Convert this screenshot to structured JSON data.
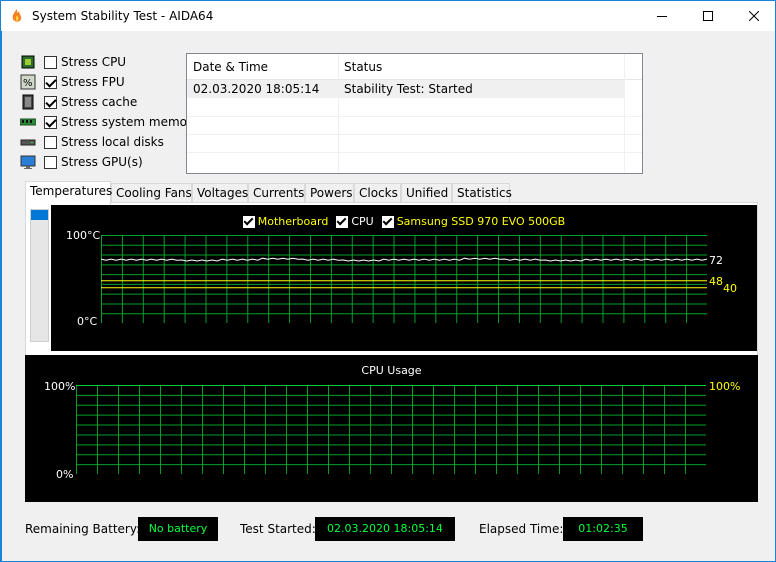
{
  "window": {
    "title": "System Stability Test - AIDA64",
    "minimize_icon": "minimize-icon",
    "maximize_icon": "maximize-icon",
    "close_icon": "close-icon"
  },
  "stress_options": [
    {
      "label": "Stress CPU",
      "checked": false,
      "icon": "cpu-chip-icon"
    },
    {
      "label": "Stress FPU",
      "checked": true,
      "icon": "fpu-percent-icon"
    },
    {
      "label": "Stress cache",
      "checked": true,
      "icon": "cache-chip-icon"
    },
    {
      "label": "Stress system memory",
      "checked": true,
      "icon": "memory-module-icon"
    },
    {
      "label": "Stress local disks",
      "checked": false,
      "icon": "disk-drive-icon"
    },
    {
      "label": "Stress GPU(s)",
      "checked": false,
      "icon": "monitor-icon"
    }
  ],
  "log": {
    "columns": [
      "Date & Time",
      "Status"
    ],
    "rows": [
      [
        "02.03.2020 18:05:14",
        "Stability Test: Started"
      ]
    ]
  },
  "tabs": [
    "Temperatures",
    "Cooling Fans",
    "Voltages",
    "Currents",
    "Powers",
    "Clocks",
    "Unified",
    "Statistics"
  ],
  "active_tab": "Temperatures",
  "temperature_graph": {
    "legend": [
      {
        "label": "Motherboard",
        "color": "#ffff00"
      },
      {
        "label": "CPU",
        "color": "#ffffff"
      },
      {
        "label": "Samsung SSD 970 EVO 500GB",
        "color": "#ffff00"
      }
    ],
    "y_max_label": "100°C",
    "y_min_label": "0°C",
    "current_values": [
      {
        "series": "CPU",
        "value": "72",
        "color": "#ffffff"
      },
      {
        "series": "Samsung SSD 970 EVO 500GB",
        "value": "48",
        "color": "#ffff00"
      },
      {
        "series": "Motherboard",
        "value": "40",
        "color": "#ffff00"
      }
    ]
  },
  "cpu_graph": {
    "title": "CPU Usage",
    "y_max_label": "100%",
    "y_min_label": "0%",
    "current_value": "100%",
    "current_color": "#ffff00"
  },
  "chart_data": [
    {
      "type": "line",
      "title": "",
      "ylim": [
        0,
        100
      ],
      "series": [
        {
          "name": "CPU",
          "values": [
            72,
            72,
            71,
            72,
            73,
            72,
            71,
            72,
            72,
            73,
            72,
            71,
            72,
            72,
            72
          ]
        },
        {
          "name": "Samsung SSD 970 EVO 500GB",
          "values": [
            48,
            48,
            48,
            48,
            48,
            48,
            48,
            48,
            48,
            48,
            48,
            48,
            48,
            48,
            48
          ]
        },
        {
          "name": "Motherboard",
          "values": [
            40,
            40,
            40,
            40,
            40,
            40,
            40,
            40,
            40,
            40,
            40,
            40,
            40,
            40,
            40
          ]
        }
      ]
    },
    {
      "type": "line",
      "title": "CPU Usage",
      "ylim": [
        0,
        100
      ],
      "series": [
        {
          "name": "",
          "values": [
            100,
            100
          ]
        }
      ]
    }
  ],
  "status_bar": {
    "battery_label": "Remaining Battery:",
    "battery_value": "No battery",
    "started_label": "Test Started:",
    "started_value": "02.03.2020 18:05:14",
    "elapsed_label": "Elapsed Time:",
    "elapsed_value": "01:02:35"
  }
}
